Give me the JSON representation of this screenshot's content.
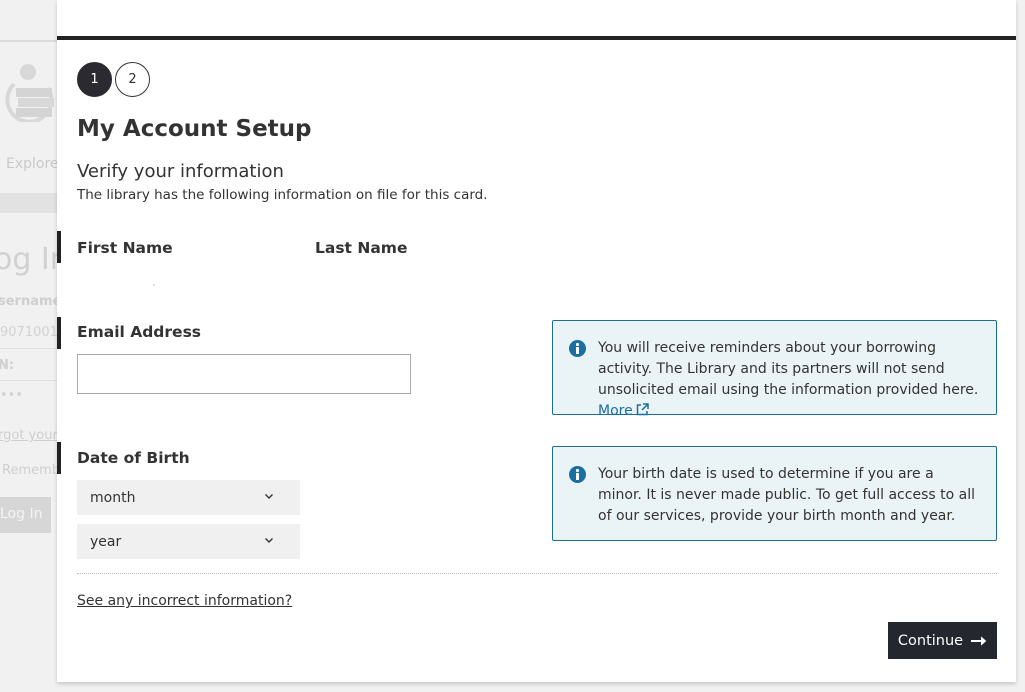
{
  "background": {
    "nav_explore": "Explore",
    "login_heading": "og In",
    "username_label": "sername",
    "username_value": "9071001",
    "pin_label": "N:",
    "pin_value": "•••",
    "forgot_link": "rgot your",
    "remember_label": "Rememb",
    "login_button": "Log In"
  },
  "steps": [
    {
      "label": "1",
      "active": true
    },
    {
      "label": "2",
      "active": false
    }
  ],
  "modal": {
    "title": "My Account Setup",
    "subtitle": "Verify your information",
    "description": "The library has the following information on file for this card.",
    "first_name_label": "First Name",
    "last_name_label": "Last Name",
    "email_label": "Email Address",
    "email_value": "",
    "email_info": "You will receive reminders about your borrowing activity. The Library and its partners will not send unsolicited email using the information provided here.",
    "email_info_link": "More",
    "dob_label": "Date of Birth",
    "month_select": "month",
    "year_select": "year",
    "dob_info": "Your birth date is used to determine if you are a minor. It is never made public. To get full access to all of our services, provide your birth month and year.",
    "incorrect_link": "See any incorrect information?",
    "continue_button": "Continue"
  },
  "colors": {
    "accent_dark": "#24282e",
    "info_border": "#1e6d8f",
    "info_bg": "#eaf4f7",
    "link": "#1a6fa0"
  }
}
